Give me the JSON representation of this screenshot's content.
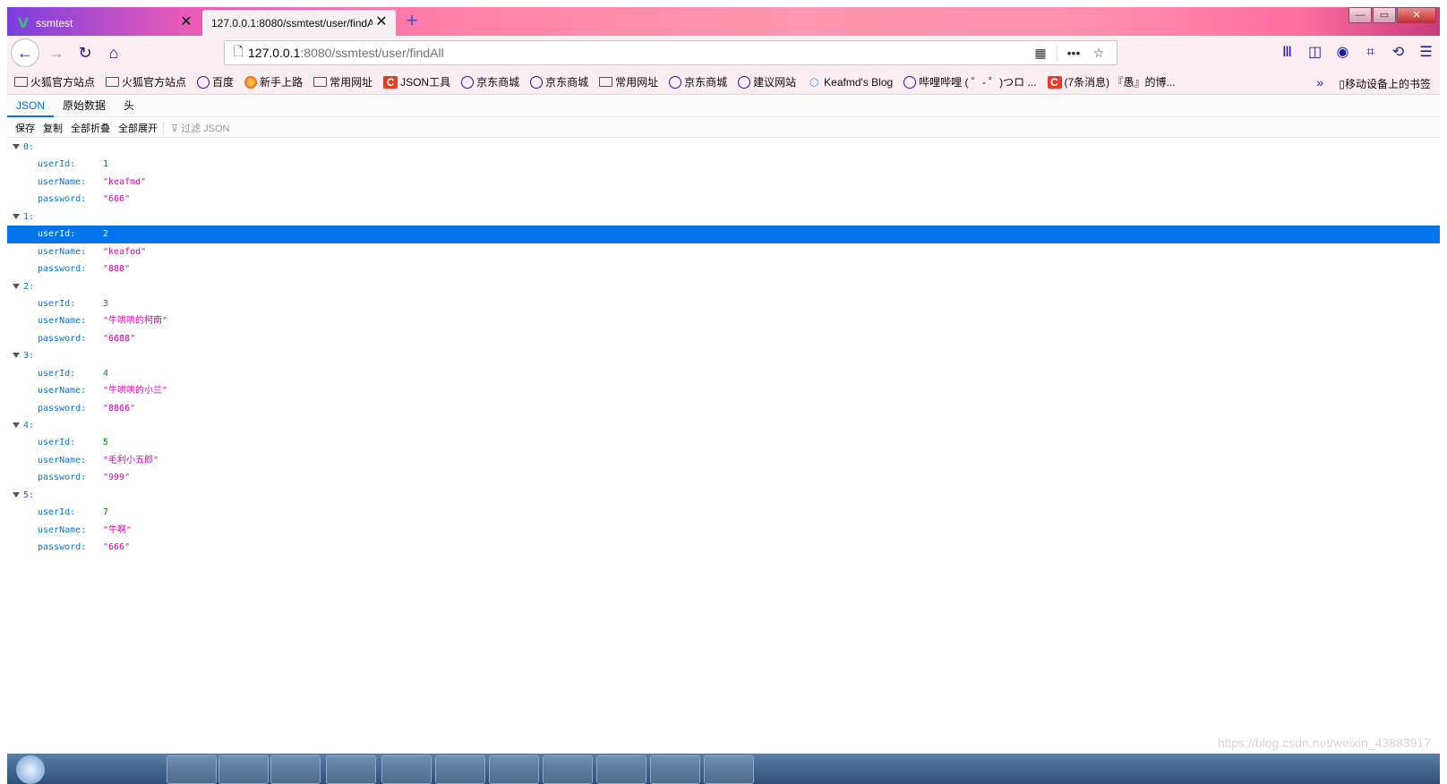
{
  "browser": {
    "tabs": [
      {
        "title": "ssmtest",
        "active": false
      },
      {
        "title": "127.0.0.1:8080/ssmtest/user/findAll",
        "active": true
      }
    ],
    "new_tab_label": "+",
    "window_controls": {
      "minimize": "—",
      "maximize": "▭",
      "close": "✕"
    },
    "url": {
      "host": "127.0.0.1",
      "path": ":8080/ssmtest/user/findAll"
    },
    "bookmarks": [
      {
        "label": "火狐官方站点",
        "icon": "folder-icon"
      },
      {
        "label": "火狐官方站点",
        "icon": "folder-icon"
      },
      {
        "label": "百度",
        "icon": "globe-icon"
      },
      {
        "label": "新手上路",
        "icon": "firefox-icon"
      },
      {
        "label": "常用网址",
        "icon": "folder-icon"
      },
      {
        "label": "JSON工具",
        "icon": "csdn-icon"
      },
      {
        "label": "京东商城",
        "icon": "globe-icon"
      },
      {
        "label": "京东商城",
        "icon": "globe-icon"
      },
      {
        "label": "常用网址",
        "icon": "folder-icon"
      },
      {
        "label": "京东商城",
        "icon": "globe-icon"
      },
      {
        "label": "建议网站",
        "icon": "globe-icon"
      },
      {
        "label": "Keafmd's Blog",
        "icon": "blog-icon"
      },
      {
        "label": "哔哩哔哩 ( ゜- ゜)つロ ...",
        "icon": "globe-icon"
      },
      {
        "label": "(7条消息) 『愚』的博...",
        "icon": "csdn-icon"
      }
    ],
    "mobile_bookmarks": "移动设备上的书签"
  },
  "json_viewer": {
    "tabs": [
      "JSON",
      "原始数据",
      "头"
    ],
    "toolbar": {
      "save": "保存",
      "copy": "复制",
      "collapse_all": "全部折叠",
      "expand_all": "全部展开",
      "filter": "过滤 JSON"
    },
    "records": [
      {
        "index": "0:",
        "userId": "1",
        "userName": "\"keafmd\"",
        "password": "\"666\""
      },
      {
        "index": "1:",
        "userId": "2",
        "userName": "\"keafod\"",
        "password": "\"888\""
      },
      {
        "index": "2:",
        "userId": "3",
        "userName": "\"牛哄哄的柯南\"",
        "password": "\"6688\""
      },
      {
        "index": "3:",
        "userId": "4",
        "userName": "\"牛哄哄的小兰\"",
        "password": "\"8866\""
      },
      {
        "index": "4:",
        "userId": "5",
        "userName": "\"毛利小五郎\"",
        "password": "\"999\""
      },
      {
        "index": "5:",
        "userId": "7",
        "userName": "\"牛啊\"",
        "password": "\"666\""
      }
    ],
    "keys": {
      "userId": "userId:",
      "userName": "userName:",
      "password": "password:"
    }
  },
  "watermark": "https://blog.csdn.net/weixin_43883917",
  "colors": {
    "accent": "#0074e8",
    "number": "#058b00",
    "string": "#dd00a9"
  }
}
